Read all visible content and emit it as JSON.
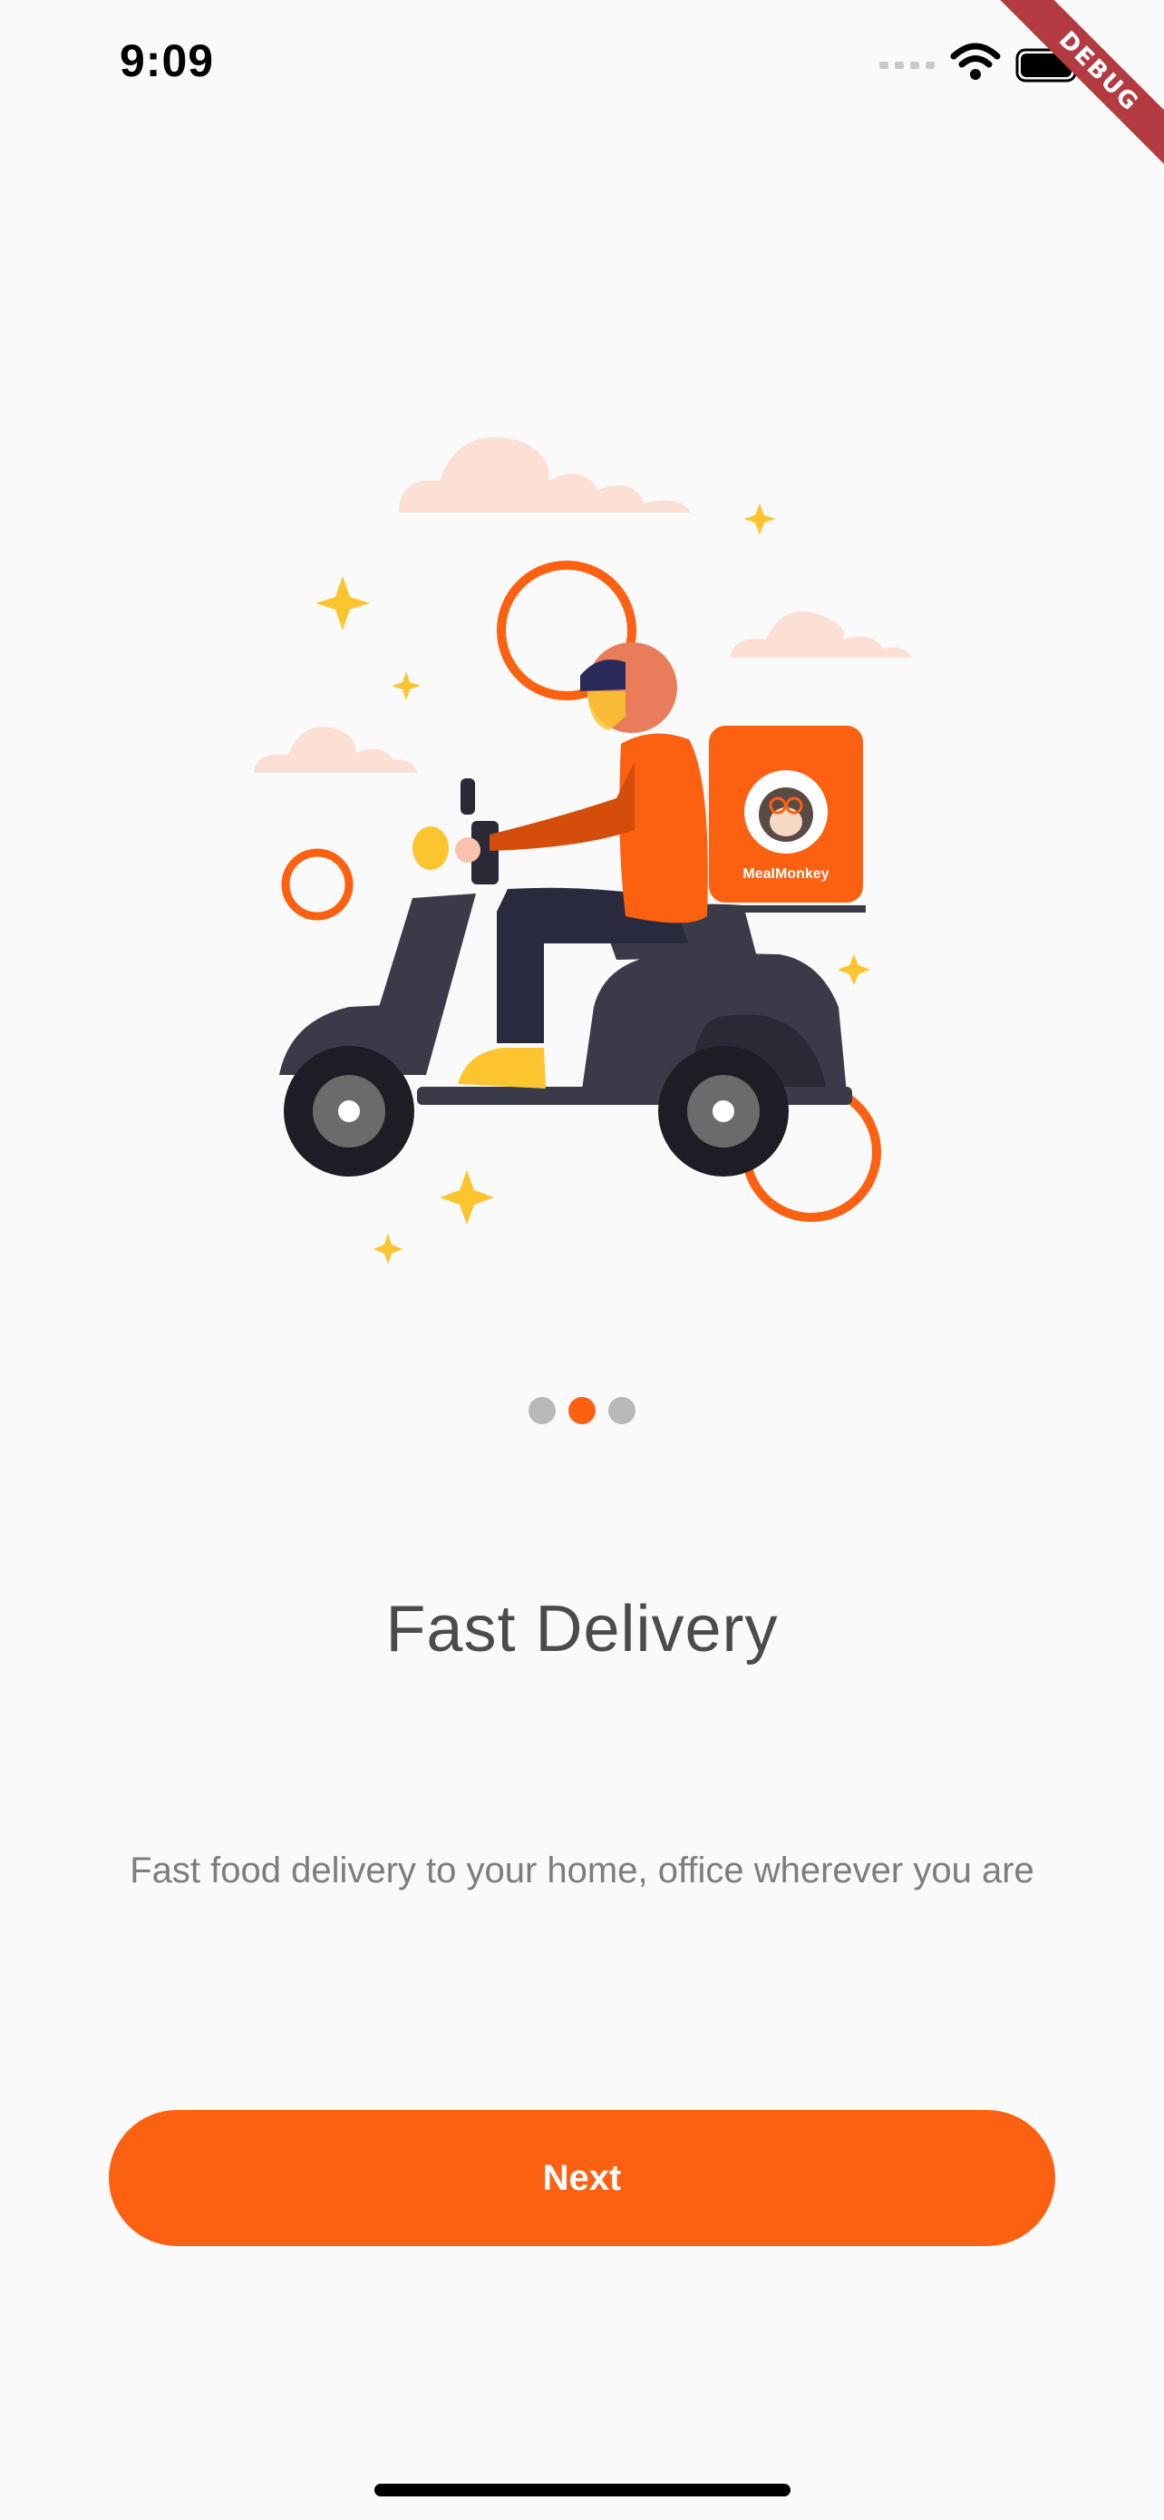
{
  "status_bar": {
    "time": "9:09",
    "icons": [
      "signal-icon",
      "wifi-icon",
      "battery-icon"
    ]
  },
  "debug_banner": {
    "label": "DEBUG",
    "color": "#b43a42"
  },
  "illustration": {
    "box_brand": "MealMonkey",
    "icon": "delivery-scooter-illustration"
  },
  "pagination": {
    "total": 3,
    "active_index": 1
  },
  "onboarding": {
    "title": "Fast Delivery",
    "subtitle": "Fast food delivery to your home, office wherever you are"
  },
  "actions": {
    "next_label": "Next"
  },
  "colors": {
    "accent": "#fc6011",
    "background": "#fafafa",
    "title_text": "#4a4b4d",
    "subtitle_text": "#7c7d7e",
    "dot_inactive": "#b8b8b8"
  }
}
